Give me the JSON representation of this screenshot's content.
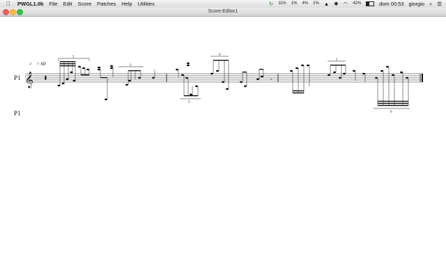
{
  "menubar": {
    "app_name": "PWGL1.0b",
    "menus": [
      "File",
      "Edit",
      "Score",
      "Patches",
      "Help",
      "Utilities"
    ],
    "status": {
      "cpu_values": [
        "11%",
        "1%",
        "4%",
        "1%"
      ],
      "battery": "42%",
      "clock": "dom 00:53",
      "user": "giorgio"
    }
  },
  "window": {
    "title": "Score-Editor1"
  },
  "score": {
    "parts": [
      {
        "label": "P1"
      },
      {
        "label": "P1"
      }
    ],
    "tempo": "= 60",
    "tuplet_labels": [
      "5",
      "3",
      "3",
      "6",
      "5",
      "6"
    ]
  }
}
